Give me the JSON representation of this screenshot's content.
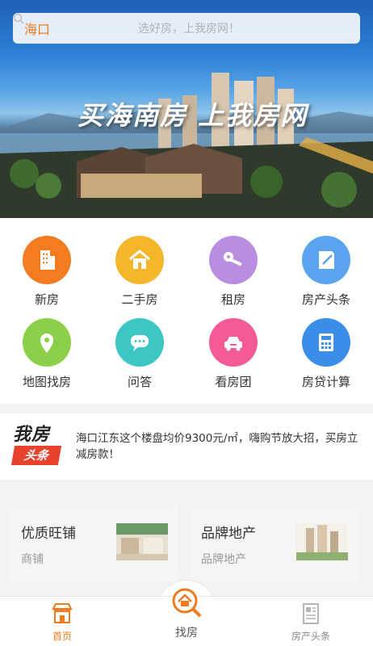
{
  "search": {
    "city": "海口",
    "placeholder": "选好房，上我房网！"
  },
  "banner": {
    "slogan": "买海南房 上我房网"
  },
  "menu": [
    {
      "label": "新房",
      "icon": "building-icon",
      "color": "#f47c20"
    },
    {
      "label": "二手房",
      "icon": "house-icon",
      "color": "#f4b62a"
    },
    {
      "label": "租房",
      "icon": "key-icon",
      "color": "#b98ee0"
    },
    {
      "label": "房产头条",
      "icon": "news-icon",
      "color": "#5aa3ee"
    },
    {
      "label": "地图找房",
      "icon": "map-pin-icon",
      "color": "#8ccf49"
    },
    {
      "label": "问答",
      "icon": "chat-icon",
      "color": "#3cc7c5"
    },
    {
      "label": "看房团",
      "icon": "car-icon",
      "color": "#f45a95"
    },
    {
      "label": "房贷计算",
      "icon": "calculator-icon",
      "color": "#3b8ee8"
    }
  ],
  "headline": {
    "logo_top": "我房",
    "logo_bottom": "头条",
    "text": "海口江东这个楼盘均价9300元/㎡，嗨购节放大招，买房立减房款！"
  },
  "cards": [
    {
      "title": "优质旺铺",
      "subtitle": "商铺"
    },
    {
      "title": "品牌地产",
      "subtitle": "品牌地产"
    }
  ],
  "tabs": [
    {
      "label": "首页",
      "icon": "storefront-icon",
      "active": true
    },
    {
      "label": "找房",
      "icon": "search-house-icon",
      "active": false
    },
    {
      "label": "房产头条",
      "icon": "newspaper-icon",
      "active": false
    }
  ],
  "colors": {
    "accent": "#f07b1f",
    "tab_inactive": "#888888"
  }
}
